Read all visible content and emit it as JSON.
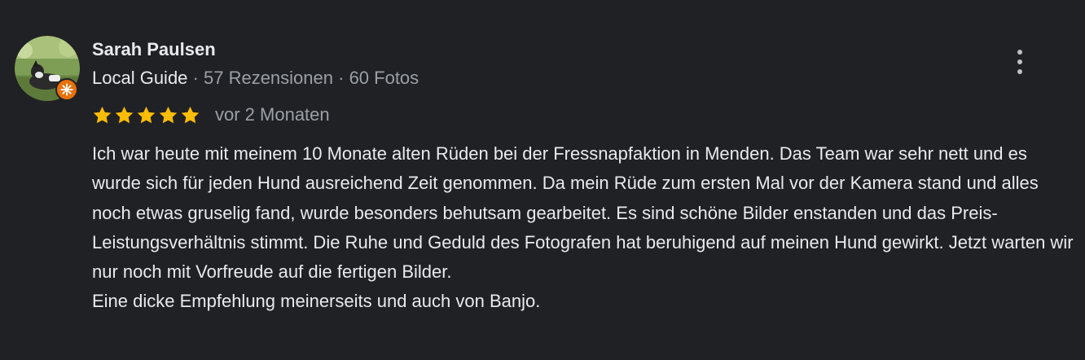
{
  "review": {
    "author": {
      "name": "Sarah Paulsen",
      "badge": "Local Guide",
      "separator": " · ",
      "reviews_count": "57 Rezensionen",
      "photos_count": "60 Fotos",
      "avatar_icon": "dog-photo-avatar",
      "badge_icon": "local-guide-star-icon"
    },
    "rating": 5,
    "rating_max": 5,
    "date": "vor 2 Monaten",
    "text_paragraph_1": "Ich war heute mit meinem 10 Monate alten Rüden bei der Fressnapfaktion in Menden. Das Team war sehr nett und es wurde sich für jeden Hund ausreichend Zeit genommen. Da mein Rüde zum ersten Mal vor der Kamera stand und alles noch etwas gruselig fand, wurde besonders behutsam gearbeitet. Es sind schöne Bilder enstanden und das Preis-Leistungsverhältnis stimmt. Die Ruhe und Geduld des Fotografen hat beruhigend auf meinen Hund gewirkt. Jetzt warten wir nur noch mit Vorfreude auf die fertigen Bilder.",
    "text_paragraph_2": "Eine dicke Empfehlung meinerseits und auch von Banjo.",
    "menu_icon": "more-vert-icon"
  },
  "colors": {
    "background": "#202124",
    "primary_text": "#e8eaed",
    "secondary_text": "#9aa0a6",
    "star": "#fbbc04",
    "badge": "#e8710a"
  }
}
